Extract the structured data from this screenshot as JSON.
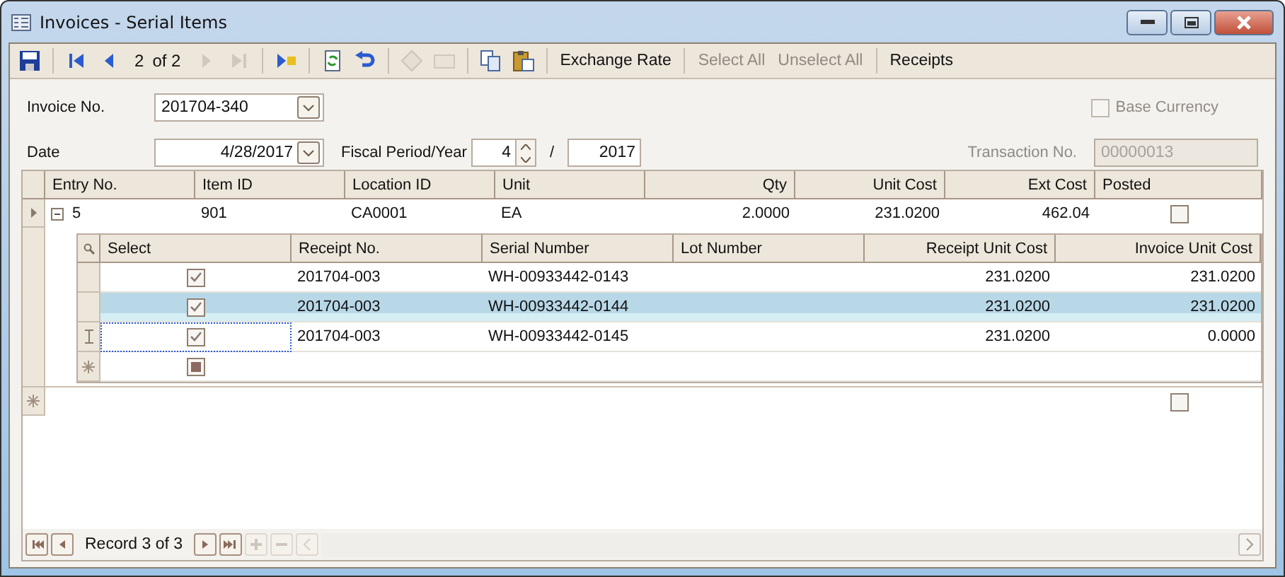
{
  "window": {
    "title": "Invoices - Serial Items"
  },
  "toolbar": [
    {
      "kind": "icon",
      "disabled": false
    },
    {
      "kind": "separator"
    },
    {
      "kind": "icon",
      "disabled": false
    },
    {
      "kind": "icon",
      "disabled": false
    },
    {
      "kind": "pager",
      "current": "2",
      "total": "of 2"
    },
    {
      "kind": "icon",
      "disabled": true
    },
    {
      "kind": "icon",
      "disabled": true
    },
    {
      "kind": "separator"
    },
    {
      "kind": "icon",
      "disabled": false
    },
    {
      "kind": "separator"
    },
    {
      "kind": "icon",
      "disabled": false
    },
    {
      "kind": "icon",
      "disabled": false
    },
    {
      "kind": "separator"
    },
    {
      "kind": "icon",
      "disabled": true
    },
    {
      "kind": "icon",
      "disabled": true
    },
    {
      "kind": "separator"
    },
    {
      "kind": "icon",
      "disabled": false
    },
    {
      "kind": "icon",
      "disabled": false
    },
    {
      "kind": "separator"
    },
    {
      "kind": "text",
      "label": "Exchange Rate",
      "disabled": false
    },
    {
      "kind": "separator"
    },
    {
      "kind": "text",
      "label": "Select All",
      "disabled": true
    },
    {
      "kind": "text",
      "label": "Unselect All",
      "disabled": true
    },
    {
      "kind": "separator"
    },
    {
      "kind": "text",
      "label": "Receipts",
      "disabled": false
    }
  ],
  "form": {
    "invoice_no": {
      "label": "Invoice No.",
      "value": "201704-340"
    },
    "date": {
      "label": "Date",
      "value": "4/28/2017"
    },
    "fiscal": {
      "label": "Fiscal Period/Year",
      "period": "4",
      "separator": "/",
      "year": "2017"
    },
    "base_currency": {
      "label": "Base Currency",
      "checked": false,
      "disabled": true
    },
    "transaction_no": {
      "label": "Transaction No.",
      "value": "00000013",
      "disabled": true
    }
  },
  "grid": {
    "columns": [
      "Entry No.",
      "Item ID",
      "Location ID",
      "Unit",
      "Qty",
      "Unit Cost",
      "Ext Cost",
      "Posted"
    ],
    "rows": [
      {
        "current": true,
        "expanded": true,
        "entry_no": "5",
        "item_id": "901",
        "location_id": "CA0001",
        "unit": "EA",
        "qty": "2.0000",
        "unit_cost": "231.0200",
        "ext_cost": "462.04",
        "posted": false,
        "serials": {
          "columns": [
            "Select",
            "Receipt No.",
            "Serial Number",
            "Lot Number",
            "Receipt Unit Cost",
            "Invoice Unit Cost"
          ],
          "rows": [
            {
              "checked": true,
              "selected": false,
              "editing": false,
              "receipt_no": "201704-003",
              "serial_number": "WH-00933442-0143",
              "receipt_unit_cost": "231.0200",
              "invoice_unit_cost": "231.0200"
            },
            {
              "checked": true,
              "selected": true,
              "editing": false,
              "receipt_no": "201704-003",
              "serial_number": "WH-00933442-0144",
              "receipt_unit_cost": "231.0200",
              "invoice_unit_cost": "231.0200"
            },
            {
              "checked": true,
              "selected": false,
              "editing": true,
              "receipt_no": "201704-003",
              "serial_number": "WH-00933442-0145",
              "receipt_unit_cost": "231.0200",
              "invoice_unit_cost": "0.0000"
            }
          ],
          "new_row": {
            "checked": false,
            "indeterminate": true
          }
        }
      }
    ],
    "new_row": {
      "posted": false
    }
  },
  "navigator": {
    "record": "Record 3 of 3",
    "buttons": [
      {
        "disabled": false
      },
      {
        "disabled": false
      },
      {
        "disabled": false
      },
      {
        "disabled": false
      },
      {
        "disabled": true
      },
      {
        "disabled": true
      },
      {
        "disabled": true
      }
    ]
  }
}
